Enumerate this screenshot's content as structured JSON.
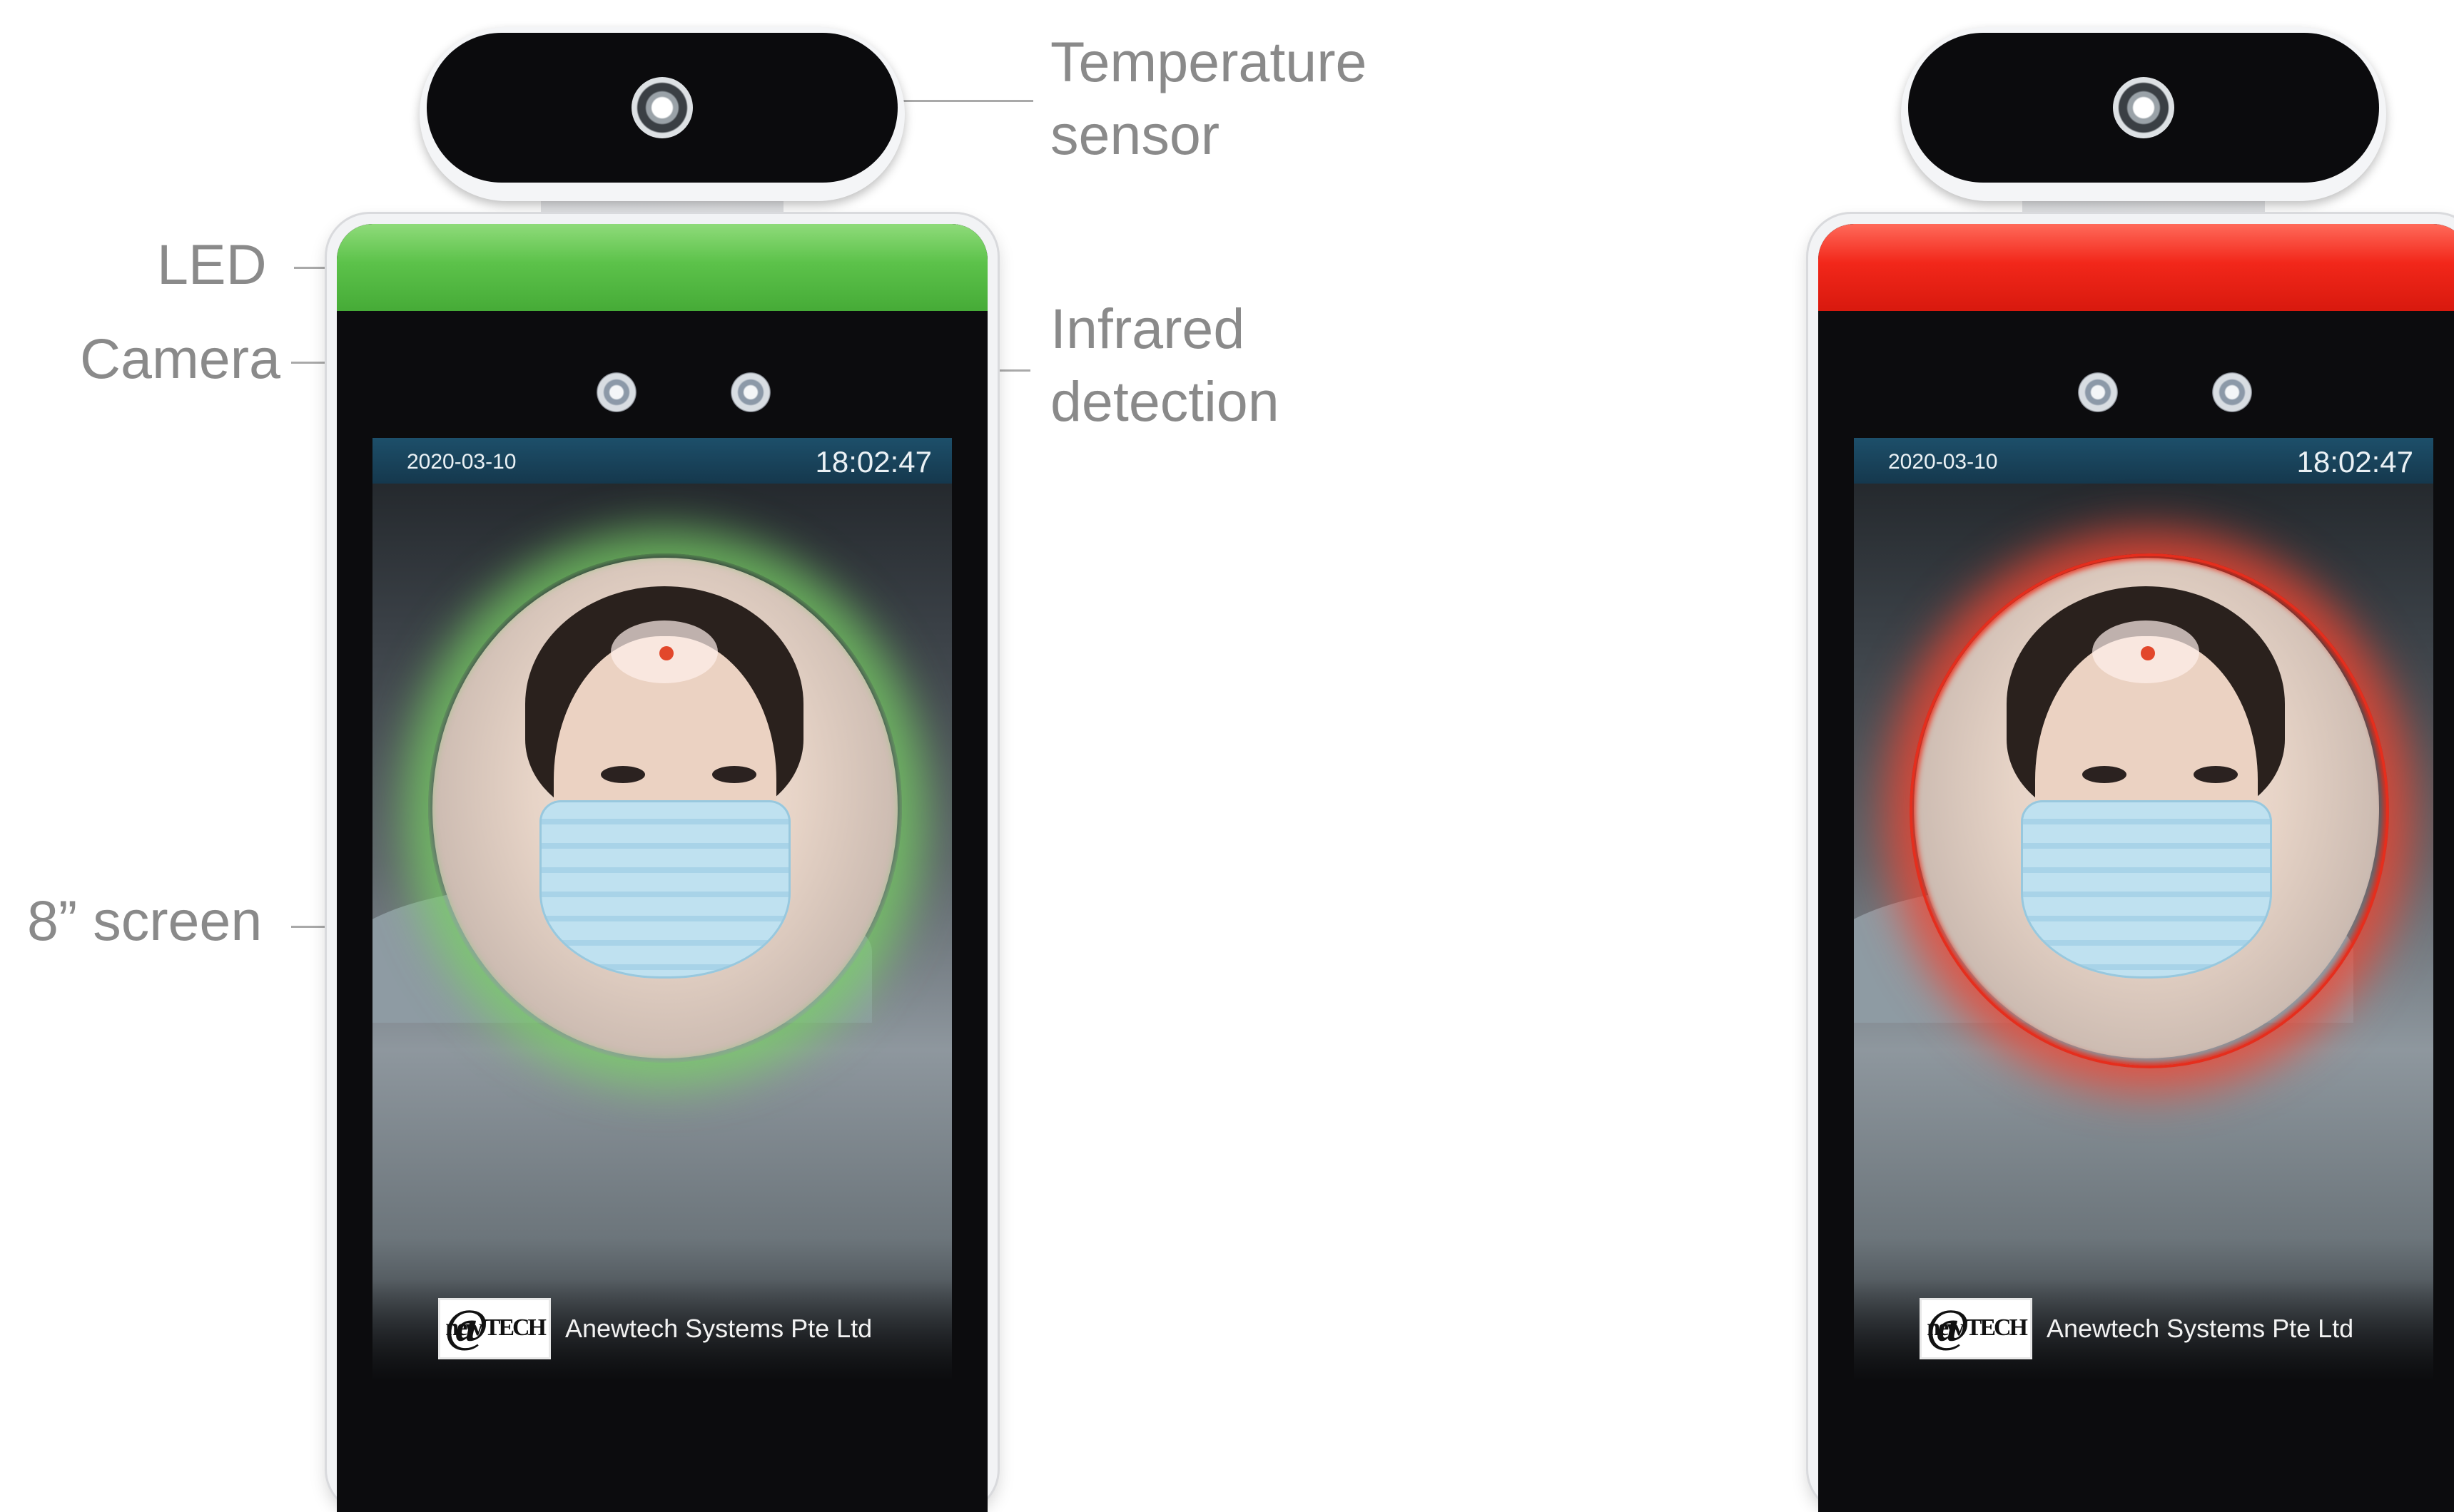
{
  "callouts": {
    "temperature_sensor": [
      "Temperature",
      "sensor"
    ],
    "led": "LED",
    "camera": "Camera",
    "infrared_detection": [
      "Infrared",
      "detection"
    ],
    "screen": "8” screen"
  },
  "devices": [
    {
      "status": "normal",
      "led_color": "#5cc24a",
      "date": "2020-03-10",
      "time": "18:02:47",
      "brand": "Anewtech Systems Pte Ltd",
      "logo_text": "@new TECH"
    },
    {
      "status": "alert",
      "led_color": "#f2271a",
      "date": "2020-03-10",
      "time": "18:02:47",
      "brand": "Anewtech Systems Pte Ltd",
      "logo_text": "@new TECH"
    }
  ]
}
